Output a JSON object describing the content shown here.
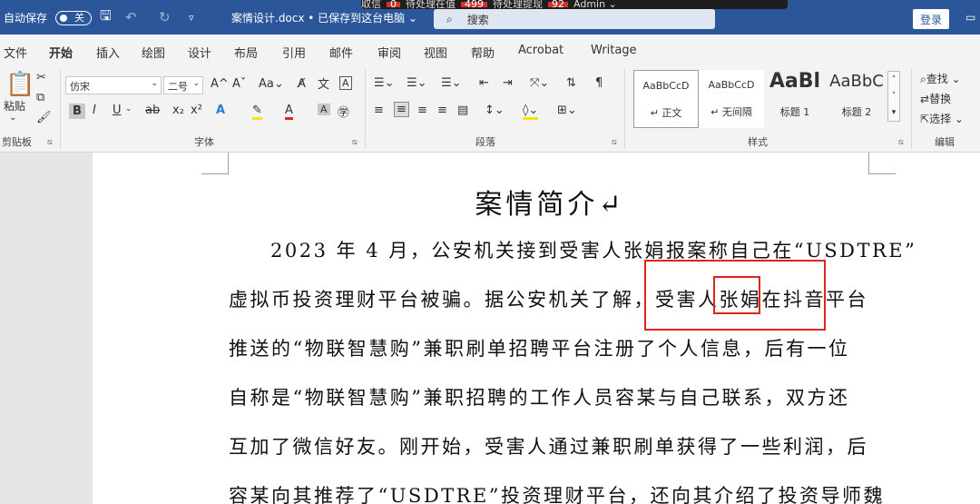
{
  "titlebar": {
    "autosave": "自动保存",
    "toggle_state": "关",
    "qat_more": "▿",
    "doc_title": "案情设计.docx • 已保存到这台电脑 ⌄",
    "search_placeholder": "搜索",
    "overlay": [
      "取信",
      "0",
      "待处理在值",
      "499",
      "待处理提现",
      "92",
      "Admin ⌄"
    ],
    "login": "登录"
  },
  "tabs": [
    "文件",
    "开始",
    "插入",
    "绘图",
    "设计",
    "布局",
    "引用",
    "邮件",
    "审阅",
    "视图",
    "帮助",
    "Acrobat",
    "Writage"
  ],
  "ribbon": {
    "clipboard": {
      "paste": "粘贴",
      "label": "剪贴板"
    },
    "font": {
      "name": "仿宋",
      "size": "二号",
      "label": "字体",
      "case": "Aa"
    },
    "paragraph": {
      "label": "段落"
    },
    "styles": {
      "label": "样式",
      "items": [
        {
          "preview": "AaBbCcD",
          "name": "↵ 正文"
        },
        {
          "preview": "AaBbCcD",
          "name": "↵ 无间隔"
        },
        {
          "preview": "AaBl",
          "name": "标题 1"
        },
        {
          "preview": "AaBbC",
          "name": "标题 2"
        }
      ]
    },
    "editing": {
      "find": "查找",
      "replace": "替换",
      "select": "选择",
      "label": "编辑"
    }
  },
  "document": {
    "title": "案情简介↵",
    "lines": [
      "2023 年 4 月，公安机关接到受害人张娟报案称自己在“USDTRE”",
      "虚拟币投资理财平台被骗。据公安机关了解，受害人张娟在抖音平台",
      "推送的“物联智慧购”兼职刷单招聘平台注册了个人信息，后有一位",
      "自称是“物联智慧购”兼职招聘的工作人员容某与自己联系，双方还",
      "互加了微信好友。刚开始，受害人通过兼职刷单获得了一些利润，后",
      "容某向其推荐了“USDTRE”投资理财平台，还向其介绍了投资导师魏"
    ]
  }
}
